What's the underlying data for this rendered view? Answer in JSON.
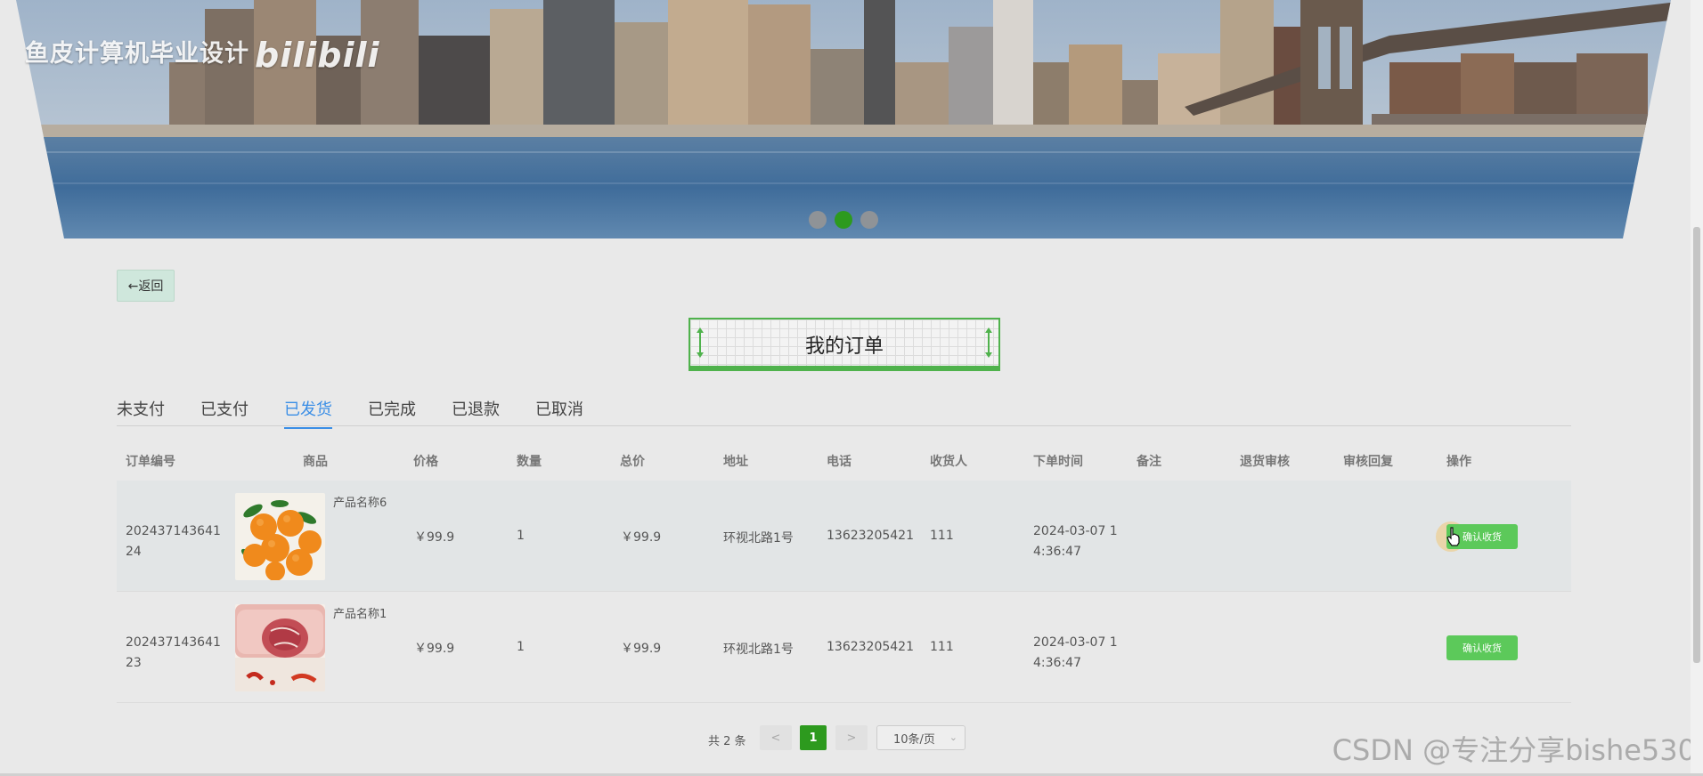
{
  "banner": {
    "watermark": "鱼皮计算机毕业设计",
    "watermark_logo": "bilibili",
    "slides": 3,
    "active_slide": 2
  },
  "back_button": "←返回",
  "page_title": "我的订单",
  "tabs": [
    "未支付",
    "已支付",
    "已发货",
    "已完成",
    "已退款",
    "已取消"
  ],
  "active_tab": "已发货",
  "columns": {
    "order_id": "订单编号",
    "product": "商品",
    "price": "价格",
    "quantity": "数量",
    "total": "总价",
    "address": "地址",
    "phone": "电话",
    "receiver": "收货人",
    "order_time": "下单时间",
    "remark": "备注",
    "refund_review": "退货审核",
    "review_reply": "审核回复",
    "actions": "操作"
  },
  "orders": [
    {
      "order_id_line1": "202437143641",
      "order_id_line2": "24",
      "product_image": "tangerines-photo",
      "product_name": "产品名称6",
      "price": "￥99.9",
      "quantity": "1",
      "total": "￥99.9",
      "address": "环视北路1号",
      "phone": "13623205421",
      "receiver": "111",
      "time_line1": "2024-03-07 1",
      "time_line2": "4:36:47",
      "action": "确认收货"
    },
    {
      "order_id_line1": "202437143641",
      "order_id_line2": "23",
      "product_image": "meat-photo",
      "product_name": "产品名称1",
      "price": "￥99.9",
      "quantity": "1",
      "total": "￥99.9",
      "address": "环视北路1号",
      "phone": "13623205421",
      "receiver": "111",
      "time_line1": "2024-03-07 1",
      "time_line2": "4:36:47",
      "action": "确认收货"
    }
  ],
  "pagination": {
    "total_text": "共 2 条",
    "prev": "<",
    "current_page": "1",
    "next": ">",
    "page_size": "10条/页"
  },
  "watermark_bottom": "CSDN @专注分享bishe530",
  "colors": {
    "accent_green": "#2d9a1e",
    "button_green": "#5cc95a",
    "active_tab_blue": "#3a8ee6",
    "title_border": "#4fb24c"
  }
}
